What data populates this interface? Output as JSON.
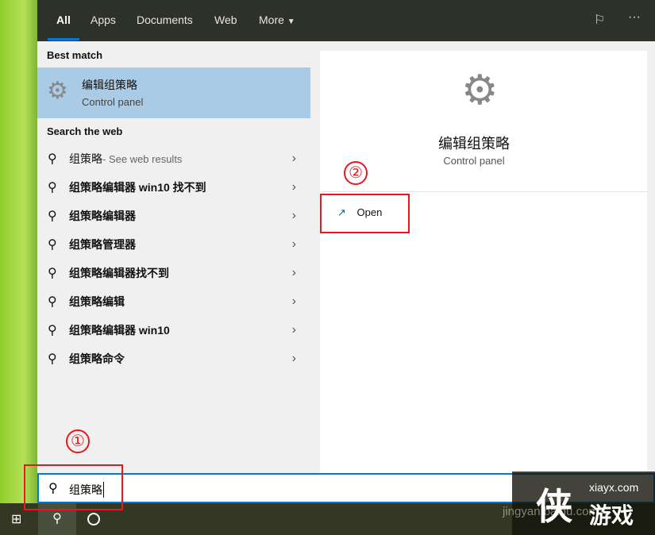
{
  "tabs": [
    "All",
    "Apps",
    "Documents",
    "Web",
    "More"
  ],
  "best_match": {
    "heading": "Best match",
    "title": "编辑组策略",
    "subtitle": "Control panel"
  },
  "web": {
    "heading": "Search the web",
    "items": [
      {
        "q": "组策略",
        "sub": " - See web results"
      },
      {
        "q": "组策略编辑器 win10 找不到"
      },
      {
        "q": "组策略编辑器"
      },
      {
        "q": "组策略管理器"
      },
      {
        "q": "组策略编辑器找不到"
      },
      {
        "q": "组策略编辑"
      },
      {
        "q": "组策略编辑器 win10"
      },
      {
        "q": "组策略命令"
      }
    ]
  },
  "preview": {
    "title": "编辑组策略",
    "subtitle": "Control panel",
    "open_label": "Open"
  },
  "search": {
    "value": "组策略"
  },
  "annotations": [
    "①",
    "②"
  ],
  "watermark": {
    "site": "xiayx.com",
    "brand": "游戏",
    "baidu": "jingyan.baidu.com"
  }
}
